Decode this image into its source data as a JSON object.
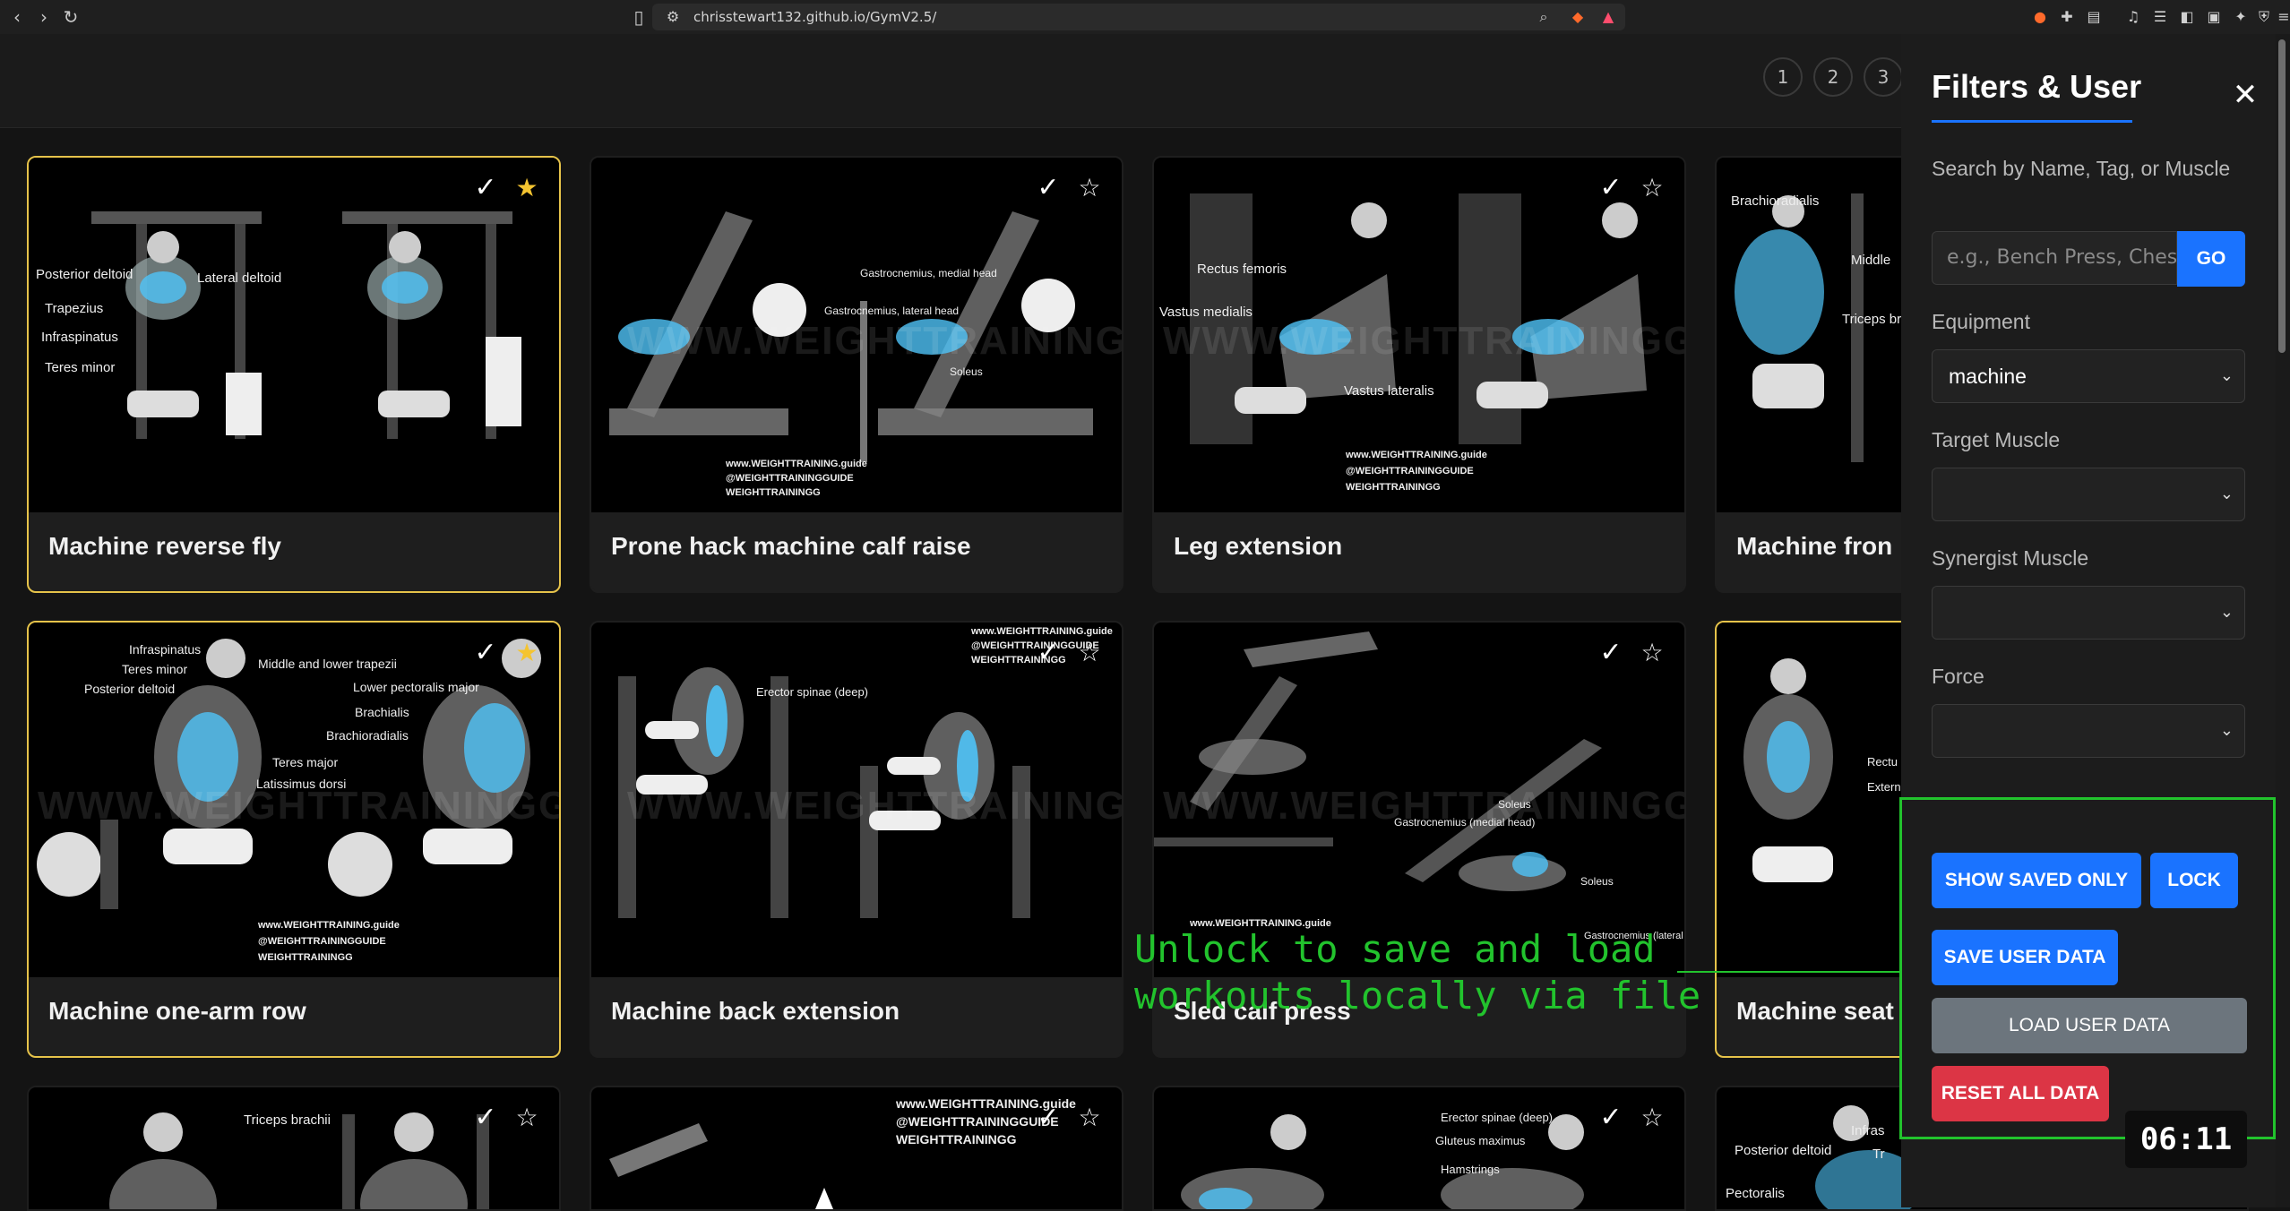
{
  "browser": {
    "url": "chrisstewart132.github.io/GymV2.5/"
  },
  "pagination": [
    "1",
    "2",
    "3"
  ],
  "cards": [
    {
      "title": "Machine reverse fly",
      "highlighted": true,
      "starred": true,
      "labels": [
        "Posterior deltoid",
        "Lateral deltoid",
        "Trapezius",
        "Infraspinatus",
        "Teres minor"
      ]
    },
    {
      "title": "Prone hack machine calf raise",
      "highlighted": false,
      "starred": false,
      "labels": [
        "Gastrocnemius, medial head",
        "Gastrocnemius, lateral head",
        "Soleus",
        "www.WEIGHTTRAINING.guide",
        "@WEIGHTTRAININGGUIDE",
        "WEIGHTTRAININGG"
      ]
    },
    {
      "title": "Leg extension",
      "highlighted": false,
      "starred": false,
      "labels": [
        "Rectus femoris",
        "Vastus medialis",
        "Vastus lateralis",
        "www.WEIGHTTRAINING.guide",
        "@WEIGHTTRAININGGUIDE",
        "WEIGHTTRAININGG"
      ]
    },
    {
      "title": "Machine fron",
      "highlighted": false,
      "starred": false,
      "labels": [
        "Brachioradialis",
        "Middle",
        "Triceps br"
      ]
    },
    {
      "title": "Machine one-arm row",
      "highlighted": true,
      "starred": true,
      "labels": [
        "Infraspinatus",
        "Teres minor",
        "Posterior deltoid",
        "Middle and lower trapezii",
        "Lower pectoralis major",
        "Brachialis",
        "Brachioradialis",
        "Teres major",
        "Latissimus dorsi",
        "www.WEIGHTTRAINING.guide",
        "@WEIGHTTRAININGGUIDE",
        "WEIGHTTRAININGG"
      ]
    },
    {
      "title": "Machine back extension",
      "highlighted": false,
      "starred": false,
      "labels": [
        "Erector spinae (deep)",
        "www.WEIGHTTRAINING.guide",
        "@WEIGHTTRAININGGUIDE",
        "WEIGHTTRAININGG"
      ]
    },
    {
      "title": "Sled calf press",
      "highlighted": false,
      "starred": false,
      "labels": [
        "Soleus",
        "Gastrocnemius (medial head)",
        "Soleus",
        "Gastrocnemius (lateral head)",
        "www.WEIGHTTRAINING.guide"
      ]
    },
    {
      "title": "Machine seat",
      "highlighted": true,
      "starred": false,
      "labels": [
        "Rectu",
        "Extern"
      ]
    },
    {
      "title": "",
      "highlighted": false,
      "starred": false,
      "labels": [
        "Triceps brachii"
      ]
    },
    {
      "title": "",
      "highlighted": false,
      "starred": false,
      "labels": [
        "www.WEIGHTTRAINING.guide",
        "@WEIGHTTRAININGGUIDE",
        "WEIGHTTRAININGG"
      ]
    },
    {
      "title": "",
      "highlighted": false,
      "starred": false,
      "labels": [
        "Erector spinae (deep)",
        "Gluteus maximus",
        "Hamstrings"
      ]
    },
    {
      "title": "",
      "highlighted": false,
      "starred": false,
      "labels": [
        "Posterior deltoid",
        "Pectoralis",
        "Infras",
        "Tr"
      ]
    }
  ],
  "watermark": "WWW.WEIGHTTRAININGGUIDE",
  "check_glyph": "✓",
  "star_glyph_on": "★",
  "star_glyph_off": "☆",
  "sidebar": {
    "title": "Filters & User",
    "close": "✕",
    "search_label": "Search by Name, Tag, or Muscle",
    "search_placeholder": "e.g., Bench Press, Chest",
    "go": "GO",
    "equipment_label": "Equipment",
    "equipment_value": "machine",
    "target_label": "Target Muscle",
    "target_value": "",
    "synergist_label": "Synergist Muscle",
    "synergist_value": "",
    "force_label": "Force",
    "force_value": "",
    "show_saved": "SHOW SAVED ONLY",
    "lock": "LOCK",
    "save_user": "SAVE USER DATA",
    "load_user": "LOAD USER DATA",
    "reset": "RESET ALL DATA",
    "timer": "06:11"
  },
  "annotation": {
    "line1": "Unlock to save and load",
    "line2": "workouts locally via file"
  },
  "colors": {
    "accent": "#1a73ff",
    "highlight_border": "#e6c34a",
    "star_on": "#f4c430",
    "danger": "#dc3545",
    "annotation": "#22c32d"
  }
}
